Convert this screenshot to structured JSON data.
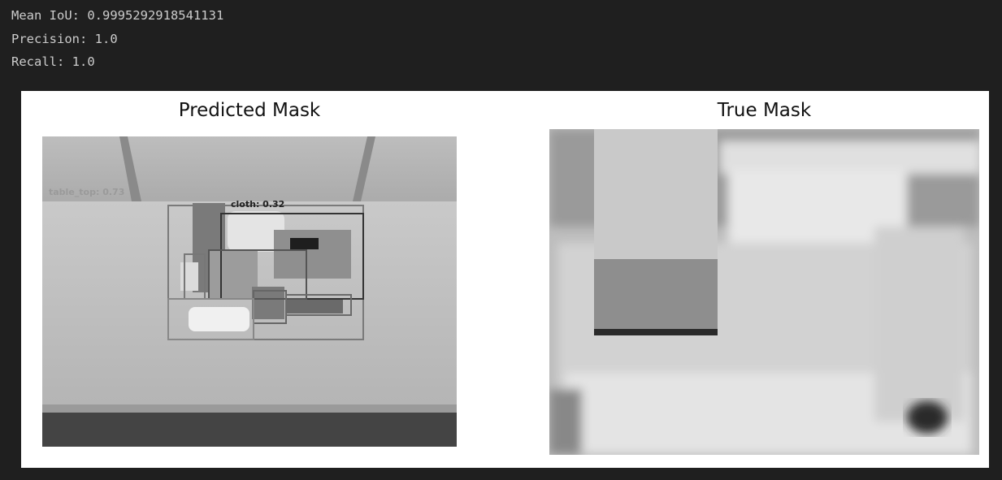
{
  "output": {
    "lines": [
      "Mean IoU: 0.9995292918541131",
      "Precision: 1.0",
      "Recall: 1.0"
    ]
  },
  "figure": {
    "left_title": "Predicted Mask",
    "right_title": "True Mask",
    "detections": [
      {
        "label": "cloth: 0.32"
      },
      {
        "label": "table_top: 0.73"
      }
    ]
  },
  "colors": {
    "notebook_bg": "#1f1f1f",
    "stdout_text": "#cccccc",
    "figure_bg": "#ffffff"
  }
}
